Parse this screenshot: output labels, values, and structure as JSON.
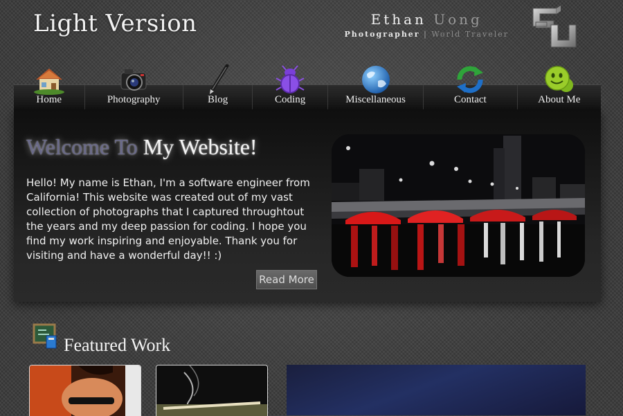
{
  "header": {
    "site_title": "Light Version",
    "name_first": "Ethan",
    "name_last": "Uong",
    "tag_primary": "Photographer",
    "tag_separator": "|",
    "tag_secondary": "World Traveler",
    "logo_icon": "eu-monogram-logo"
  },
  "nav": {
    "items": [
      {
        "label": "Home",
        "icon": "house-icon"
      },
      {
        "label": "Photography",
        "icon": "camera-icon"
      },
      {
        "label": "Blog",
        "icon": "pen-icon"
      },
      {
        "label": "Coding",
        "icon": "bug-icon"
      },
      {
        "label": "Miscellaneous",
        "icon": "globe-icon"
      },
      {
        "label": "Contact",
        "icon": "refresh-arrows-icon"
      },
      {
        "label": "About Me",
        "icon": "smiley-icon"
      }
    ]
  },
  "hero": {
    "title_part1": "Welcome To",
    "title_part2": "My Website!",
    "text": "Hello! My name is Ethan, I'm a software engineer from California! This website was created out of my vast collection of photographs that I captured throughtout the years and my deep passion for coding. I hope you find my work inspiring and enjoyable. Thank you for visiting and have a wonderful day!! :)",
    "read_more": "Read More",
    "image_subject": "night-bridge-photo"
  },
  "featured": {
    "title": "Featured Work",
    "icon": "chalkboard-icon"
  },
  "colors": {
    "background": "#3a3a3a",
    "nav_bar": "#1c1c1c",
    "accent_red": "#d01818",
    "title_glow": "#ffffff"
  }
}
